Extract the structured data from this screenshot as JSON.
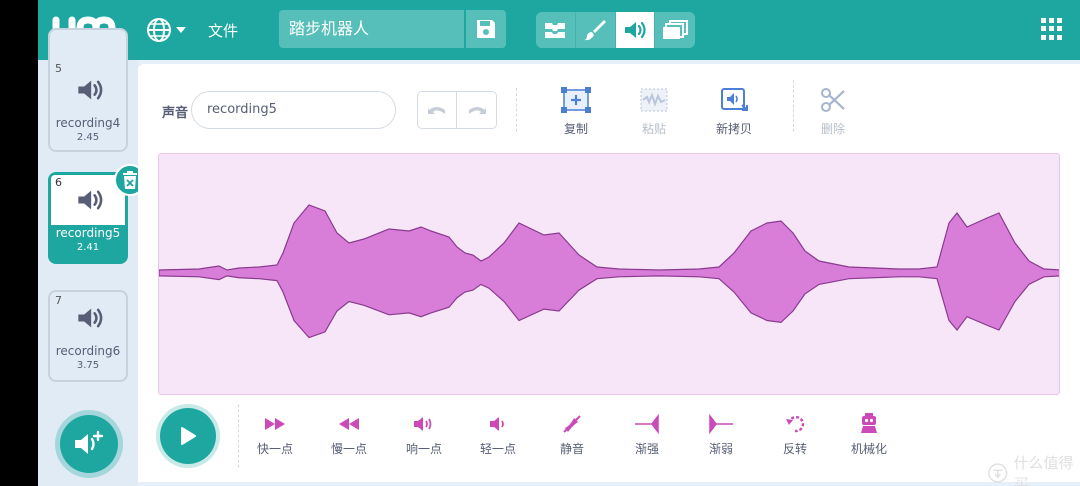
{
  "colors": {
    "teal": "#1ea7a0",
    "wave": "#d87ed8",
    "wave_stroke": "#8a3a8f",
    "wave_bg": "#f7e6f7"
  },
  "topbar": {
    "file_label": "文件",
    "project_title": "踏步机器人",
    "mode_tabs": [
      "code-icon",
      "brush-icon",
      "speaker-icon",
      "stage-icon"
    ],
    "active_tab": 2
  },
  "sidebar": {
    "sounds": [
      {
        "num": "5",
        "name": "recording4",
        "duration": "2.45",
        "selected": false
      },
      {
        "num": "6",
        "name": "recording5",
        "duration": "2.41",
        "selected": true
      },
      {
        "num": "7",
        "name": "recording6",
        "duration": "3.75",
        "selected": false
      }
    ]
  },
  "editor": {
    "sound_label": "声音",
    "sound_name": "recording5",
    "tools": {
      "copy": "复制",
      "paste": "粘贴",
      "copy_new": "新拷贝",
      "delete": "删除"
    },
    "effects": {
      "faster": "快一点",
      "slower": "慢一点",
      "louder": "响一点",
      "softer": "轻一点",
      "mute": "静音",
      "fade_in": "渐强",
      "fade_out": "渐弱",
      "reverse": "反转",
      "robot": "机械化"
    }
  },
  "watermark": "什么值得买"
}
